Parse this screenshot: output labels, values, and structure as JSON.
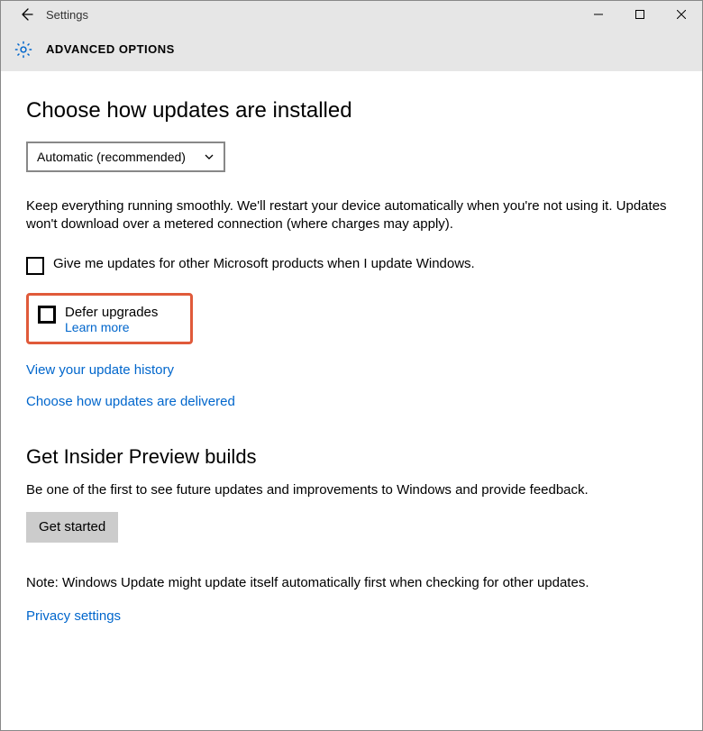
{
  "window": {
    "title": "Settings"
  },
  "header": {
    "subtitle": "ADVANCED OPTIONS"
  },
  "section1": {
    "heading": "Choose how updates are installed",
    "combo_value": "Automatic (recommended)",
    "description": "Keep everything running smoothly. We'll restart your device automatically when you're not using it. Updates won't download over a metered connection (where charges may apply).",
    "cb_other_products": "Give me updates for other Microsoft products when I update Windows.",
    "defer": {
      "label": "Defer upgrades",
      "learn_more": "Learn more"
    },
    "link_history": "View your update history",
    "link_delivered": "Choose how updates are delivered"
  },
  "section2": {
    "heading": "Get Insider Preview builds",
    "description": "Be one of the first to see future updates and improvements to Windows and provide feedback.",
    "button": "Get started"
  },
  "footer": {
    "note": "Note: Windows Update might update itself automatically first when checking for other updates.",
    "privacy": "Privacy settings"
  }
}
